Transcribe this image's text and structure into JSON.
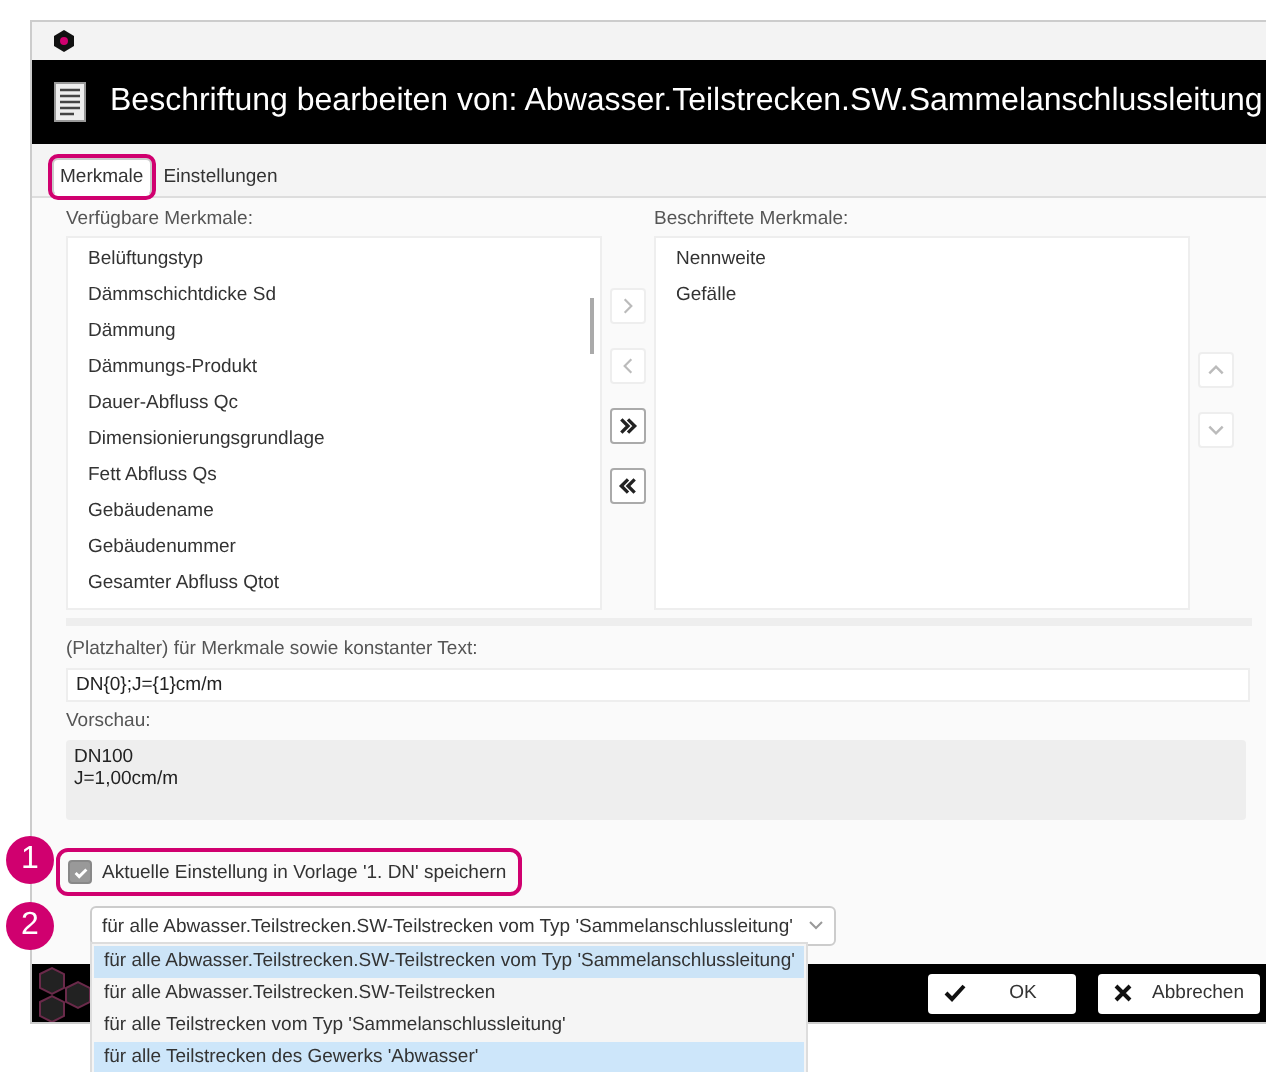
{
  "window": {
    "title": "Beschriftung bearbeiten von: Abwasser.Teilstrecken.SW.Sammelanschlussleitung"
  },
  "tabs": [
    {
      "label": "Merkmale",
      "selected": true,
      "highlighted": true
    },
    {
      "label": "Einstellungen",
      "selected": false,
      "highlighted": false
    }
  ],
  "available": {
    "label": "Verfügbare Merkmale:",
    "items": [
      "Belüftungstyp",
      "Dämmschichtdicke Sd",
      "Dämmung",
      "Dämmungs-Produkt",
      "Dauer-Abfluss Qc",
      "Dimensionierungsgrundlage",
      "Fett Abfluss Qs",
      "Gebäudename",
      "Gebäudenummer",
      "Gesamter Abfluss Qtot"
    ]
  },
  "transfer_buttons": [
    {
      "kind": "add",
      "disabled": true
    },
    {
      "kind": "remove",
      "disabled": true
    },
    {
      "kind": "add_all",
      "disabled": false
    },
    {
      "kind": "remove_all",
      "disabled": false
    }
  ],
  "labeled": {
    "label": "Beschriftete Merkmale:",
    "items": [
      "Nennweite",
      "Gefälle"
    ]
  },
  "order_buttons": [
    {
      "kind": "up",
      "disabled": true
    },
    {
      "kind": "down",
      "disabled": true
    }
  ],
  "pattern": {
    "label": "(Platzhalter) für Merkmale sowie konstanter Text:",
    "value": "DN{0};J={1}cm/m"
  },
  "preview": {
    "label": "Vorschau:",
    "lines": [
      "DN100",
      "J=1,00cm/m"
    ]
  },
  "save_template": {
    "label": "Aktuelle Einstellung in Vorlage '1. DN' speichern",
    "checked": true,
    "highlighted": true
  },
  "scope_dropdown": {
    "value": "für alle Abwasser.Teilstrecken.SW-Teilstrecken vom Typ 'Sammelanschlussleitung'",
    "expanded": true,
    "options": [
      {
        "label": "für alle Abwasser.Teilstrecken.SW-Teilstrecken vom Typ 'Sammelanschlussleitung'",
        "selected": true,
        "hovered": false
      },
      {
        "label": "für alle Abwasser.Teilstrecken.SW-Teilstrecken",
        "selected": false,
        "hovered": false
      },
      {
        "label": "für alle Teilstrecken vom Typ 'Sammelanschlussleitung'",
        "selected": false,
        "hovered": false
      },
      {
        "label": "für alle Teilstrecken des Gewerks 'Abwasser'",
        "selected": false,
        "hovered": true
      }
    ]
  },
  "annotations": [
    "1",
    "2"
  ],
  "buttons": [
    {
      "kind": "ok",
      "label": "OK"
    },
    {
      "kind": "cancel",
      "label": "Abbrechen"
    }
  ]
}
